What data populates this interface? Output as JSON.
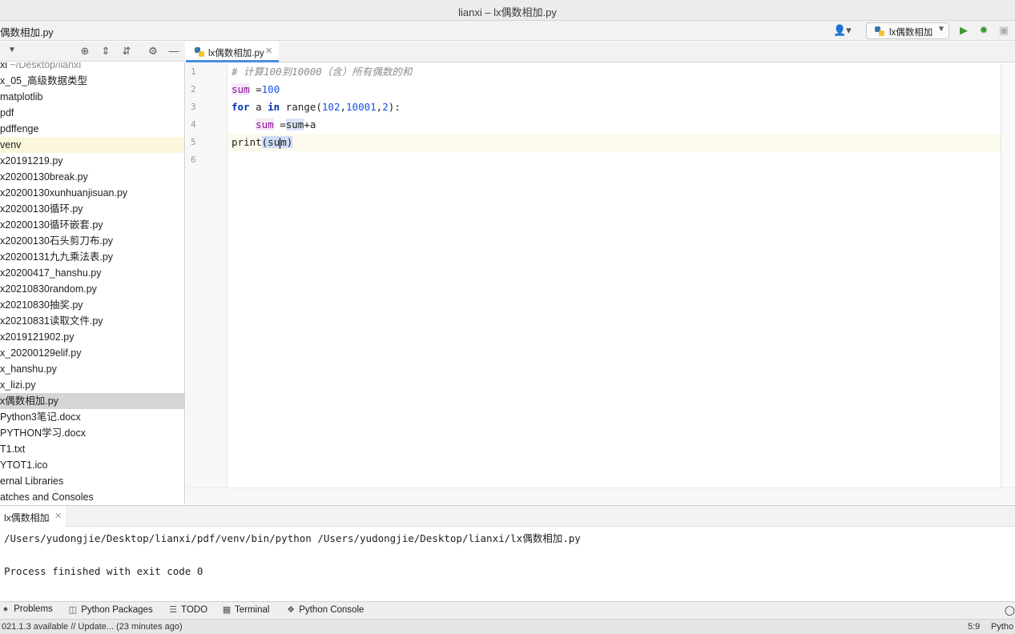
{
  "window": {
    "title": "lianxi – lx偶数相加.py"
  },
  "navbar": {
    "breadcrumb": "偶数相加.py",
    "run_config": "lx偶数相加"
  },
  "project": {
    "items": [
      {
        "label": "xi",
        "suffix": " ~/Desktop/lianxi"
      },
      {
        "label": "x_05_高级数据类型"
      },
      {
        "label": "matplotlib"
      },
      {
        "label": "pdf"
      },
      {
        "label": "pdffenge"
      },
      {
        "label": "venv"
      },
      {
        "label": "x20191219.py"
      },
      {
        "label": "x20200130break.py"
      },
      {
        "label": "x20200130xunhuanjisuan.py"
      },
      {
        "label": "x20200130循环.py"
      },
      {
        "label": "x20200130循环嵌套.py"
      },
      {
        "label": "x20200130石头剪刀布.py"
      },
      {
        "label": "x20200131九九乘法表.py"
      },
      {
        "label": "x20200417_hanshu.py"
      },
      {
        "label": "x20210830random.py"
      },
      {
        "label": "x20210830抽奖.py"
      },
      {
        "label": "x20210831读取文件.py"
      },
      {
        "label": "x2019121902.py"
      },
      {
        "label": "x_20200129elif.py"
      },
      {
        "label": "x_hanshu.py"
      },
      {
        "label": "x_lizi.py"
      },
      {
        "label": "x偶数相加.py"
      },
      {
        "label": "Python3笔记.docx"
      },
      {
        "label": "PYTHON学习.docx"
      },
      {
        "label": "T1.txt"
      },
      {
        "label": "YTOT1.ico"
      },
      {
        "label": "ernal Libraries"
      },
      {
        "label": "atches and Consoles"
      }
    ]
  },
  "editor": {
    "tab_label": "lx偶数相加.py",
    "line_numbers": [
      "1",
      "2",
      "3",
      "4",
      "5",
      "6"
    ],
    "code": {
      "l1": "# 计算100到10000（含）所有偶数的和",
      "l2_var": "sum",
      "l2_op": " =",
      "l2_num": "100",
      "l3_for": "for",
      "l3_a": " a ",
      "l3_in": "in",
      "l3_range": " range(",
      "l3_n1": "102",
      "l3_c1": ",",
      "l3_n2": "10001",
      "l3_c2": ",",
      "l3_n3": "2",
      "l3_end": "):",
      "l4_indent": "    ",
      "l4_var": "sum",
      "l4_op": " =",
      "l4_sum": "sum",
      "l4_rest": "+a",
      "l5_print": "print",
      "l5_paren": "(",
      "l5_su": "su",
      "l5_m": "m",
      "l5_close": ")"
    }
  },
  "run": {
    "tab_label": "lx偶数相加",
    "command": "/Users/yudongjie/Desktop/lianxi/pdf/venv/bin/python /Users/yudongjie/Desktop/lianxi/lx偶数相加.py",
    "finished": "Process finished with exit code 0"
  },
  "tool_windows": {
    "problems": "Problems",
    "python_packages": "Python Packages",
    "todo": "TODO",
    "terminal": "Terminal",
    "python_console": "Python Console"
  },
  "status": {
    "message": "021.1.3 available // Update... (23 minutes ago)",
    "position": "5:9",
    "interpreter": "Pytho"
  },
  "colors": {
    "tab_underline": "#4a8de0",
    "keyword": "#0033b3",
    "number": "#1750eb",
    "comment": "#8c8c8c",
    "run_green": "#3f9c35"
  }
}
